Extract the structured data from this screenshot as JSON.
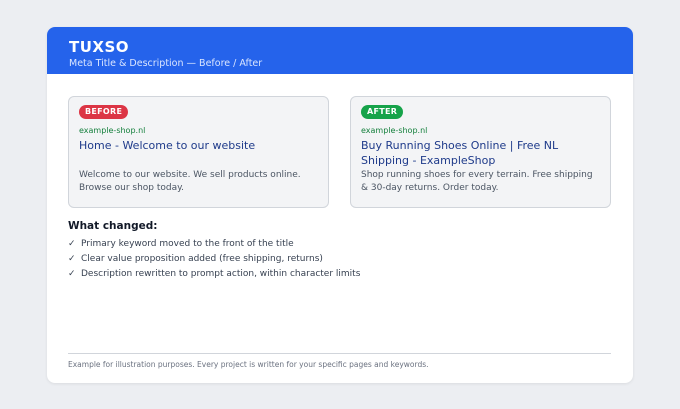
{
  "header": {
    "brand": "TUXSO",
    "subtitle": "Meta Title & Description — Before / After"
  },
  "before": {
    "badge": "BEFORE",
    "badge_color": "#dc3545",
    "url": "example-shop.nl",
    "title": "Home - Welcome to our website",
    "description": "Welcome to our website. We sell products online. Browse our shop today."
  },
  "after": {
    "badge": "AFTER",
    "badge_color": "#16a34a",
    "url": "example-shop.nl",
    "title": "Buy Running Shoes Online | Free NL Shipping - ExampleShop",
    "description": "Shop running shoes for every terrain. Free shipping & 30-day returns. Order today."
  },
  "changes": {
    "heading": "What changed:",
    "check_symbol": "✓",
    "items": [
      "Primary keyword moved to the front of the title",
      "Clear value proposition added (free shipping, returns)",
      "Description rewritten to prompt action, within character limits"
    ]
  },
  "footer": {
    "note": "Example for illustration purposes. Every project is written for your specific pages and keywords."
  },
  "colors": {
    "header_bg": "#2563eb",
    "title_link": "#1e3a8a",
    "url_green": "#15803d"
  }
}
